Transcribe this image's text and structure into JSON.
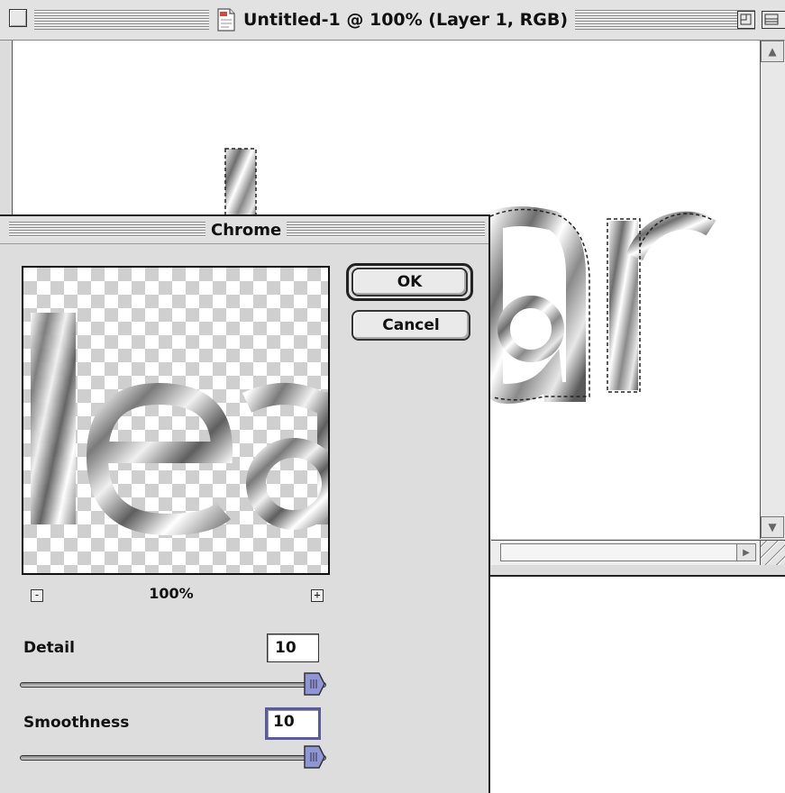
{
  "document_window": {
    "title": "Untitled-1 @ 100% (Layer 1, RGB)",
    "canvas_text_partial": "ar"
  },
  "dialog": {
    "title": "Chrome",
    "ok_label": "OK",
    "cancel_label": "Cancel",
    "preview": {
      "text": "lea",
      "zoom": "100%",
      "zoom_out_symbol": "-",
      "zoom_in_symbol": "+"
    },
    "detail": {
      "label": "Detail",
      "value": "10",
      "min": 0,
      "max": 10
    },
    "smoothness": {
      "label": "Smoothness",
      "value": "10",
      "min": 0,
      "max": 10
    }
  },
  "colors": {
    "chrome_gray": "#dddddd",
    "focus_ring": "#5a5aa0",
    "slider_thumb": "#8f96d8"
  },
  "icons": [
    "close-box-icon",
    "document-icon",
    "zoom-box-icon",
    "collapse-box-icon",
    "scroll-up-icon",
    "scroll-down-icon",
    "scroll-right-icon",
    "grow-box-icon"
  ]
}
